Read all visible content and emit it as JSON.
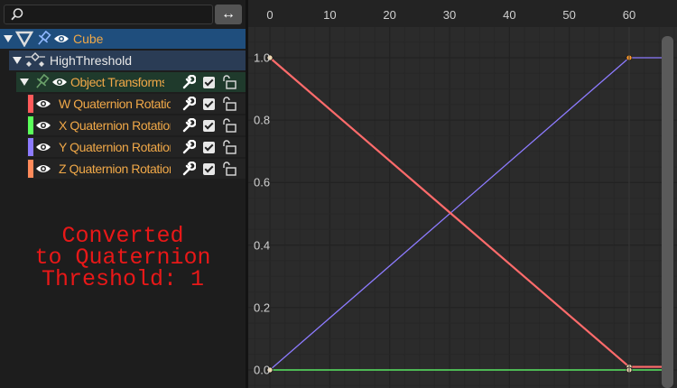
{
  "search": {
    "placeholder": ""
  },
  "swap_label": "↔",
  "tree": {
    "object": "Cube",
    "action": "HighThreshold",
    "group": "Object Transforms",
    "channels": [
      {
        "label": "W Quaternion Rotation",
        "color": "#ff5a5a"
      },
      {
        "label": "X Quaternion Rotation",
        "color": "#5aff5a"
      },
      {
        "label": "Y Quaternion Rotation",
        "color": "#8d7bff"
      },
      {
        "label": "Z Quaternion Rotation",
        "color": "#ff8a5a"
      }
    ]
  },
  "message": "Converted\nto Quaternion\nThreshold: 1",
  "chart_data": {
    "type": "line",
    "x_ticks": [
      0,
      10,
      20,
      30,
      40,
      50,
      60
    ],
    "y_ticks": [
      "1.0",
      "0.8",
      "0.6",
      "0.4",
      "0.2",
      "0.0"
    ],
    "xlim": [
      0,
      67
    ],
    "ylim": [
      -0.05,
      1.1
    ],
    "grid": true,
    "series": [
      {
        "name": "W Quaternion Rotation",
        "color": "#ff6b6b",
        "x": [
          0,
          60,
          67
        ],
        "y": [
          1.0,
          0.01,
          0.01
        ]
      },
      {
        "name": "X Quaternion Rotation",
        "color": "#5aff5a",
        "x": [
          0,
          60,
          67
        ],
        "y": [
          0.0,
          0.0,
          0.0
        ]
      },
      {
        "name": "Y Quaternion Rotation",
        "color": "#8d7bff",
        "x": [
          0,
          60,
          67
        ],
        "y": [
          0.0,
          1.0,
          1.0
        ]
      },
      {
        "name": "Z Quaternion Rotation",
        "color": "#6a8bb8",
        "x": [
          0,
          60,
          67
        ],
        "y": [
          0.0,
          0.0,
          0.0
        ]
      }
    ]
  }
}
